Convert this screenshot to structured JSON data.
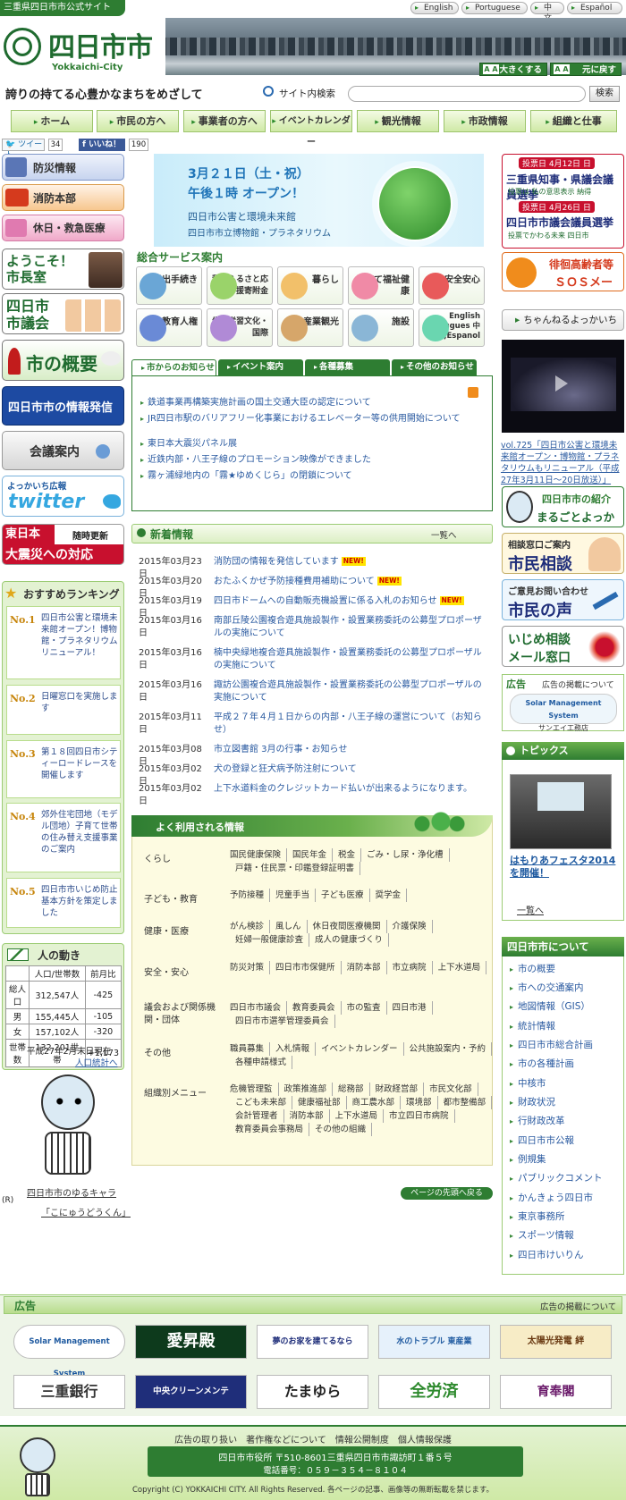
{
  "header": {
    "site_label": "三重県四日市市公式サイト",
    "languages": [
      "English",
      "Portuguese",
      "中文",
      "Español"
    ],
    "logo_text": "四日市市",
    "logo_sub": "Yokkaichi-City",
    "font_large": "大きくする",
    "font_reset": "元に戻す",
    "slogan": "誇りの持てる心豊かなまちをめざして",
    "search_label": "サイト内検索",
    "search_value": "",
    "search_button": "検索"
  },
  "nav": [
    "ホーム",
    "市民の方へ",
    "事業者の方へ",
    "イベントカレンダー",
    "観光情報",
    "市政情報",
    "組織と仕事"
  ],
  "social": {
    "tweet": "ツイート",
    "tweet_count": "34",
    "like": "いいね！",
    "like_count": "190"
  },
  "left_buttons": [
    "防災情報",
    "消防本部",
    "休日・救急医療"
  ],
  "left_banners": {
    "mayor": "ようこそ！市長室",
    "council": "四日市市議会",
    "overview": "市の概要",
    "info": "四日市市の情報発信",
    "meeting": "会議案内",
    "twitter_top": "よっかいち広報",
    "twitter": "twitter",
    "quake_top": "東日本",
    "quake_tag": "随時更新",
    "quake": "大震災への対応"
  },
  "ranking": {
    "title": "おすすめランキング",
    "items": [
      {
        "no": "No.1",
        "text": "四日市公害と環境未来館オープン！博物館・プラネタリウムリニューアル！"
      },
      {
        "no": "No.2",
        "text": "日曜窓口を実施します"
      },
      {
        "no": "No.3",
        "text": "第１８回四日市シティーロードレースを開催します"
      },
      {
        "no": "No.4",
        "text": "郊外住宅団地（モデル団地）子育て世帯の住み替え支援事業のご案内"
      },
      {
        "no": "No.5",
        "text": "四日市市いじめ防止基本方針を策定しました"
      }
    ]
  },
  "population": {
    "title": "人の動き",
    "headers": [
      "",
      "人口/世帯数",
      "前月比"
    ],
    "rows": [
      {
        "label": "総人口",
        "value": "312,547人",
        "diff": "-425"
      },
      {
        "label": "男",
        "value": "155,445人",
        "diff": "-105"
      },
      {
        "label": "女",
        "value": "157,102人",
        "diff": "-320"
      },
      {
        "label": "世帯数",
        "value": "132,201世帯",
        "diff": "+1,173"
      }
    ],
    "note": "平成27年2月末日現在",
    "link": "人口統計へ"
  },
  "mascot": {
    "caption": "四日市市のゆるキャラ",
    "r": "(R)",
    "name": "「こにゅうどうくん」"
  },
  "hero": {
    "line1": "3月２１日（土・祝）",
    "line2": "午後１時 オープン！",
    "line3": "四日市公害と環境未来館",
    "line4": "四日市市立博物館・プラネタリウム"
  },
  "services": {
    "title": "総合サービス案内",
    "items": [
      "届出手続き",
      "税金ふるさと応援寄附金",
      "暮らし",
      "子育て福祉健康",
      "安全安心",
      "教育人権",
      "生涯学習文化・国際",
      "産業観光",
      "施設",
      "English Portugues 中文,Espanol"
    ]
  },
  "news_tabs": [
    "市からのお知らせ",
    "イベント案内",
    "各種募集",
    "その他のお知らせ"
  ],
  "news_items": [
    "鉄道事業再構築実施計画の国土交通大臣の認定について",
    "JR四日市駅のバリアフリー化事業におけるエレベーター等の供用開始について",
    "東日本大震災パネル展",
    "近鉄内部・八王子線のプロモーション映像ができました",
    "霧ヶ浦緑地内の「霧★ゆめくじら」の閉鎖について"
  ],
  "new_info": {
    "title": "新着情報",
    "list_link": "一覧へ",
    "new_badge": "NEW!",
    "rows": [
      {
        "date": "2015年03月23日",
        "text": "消防団の情報を発信しています",
        "new": true
      },
      {
        "date": "2015年03月20日",
        "text": "おたふくかぜ予防接種費用補助について",
        "new": true
      },
      {
        "date": "2015年03月19日",
        "text": "四日市ドームへの自動販売機設置に係る入札のお知らせ",
        "new": true
      },
      {
        "date": "2015年03月16日",
        "text": "南部丘陵公園複合遊具施設製作・設置業務委託の公募型プロポーザルの実施について",
        "new": false
      },
      {
        "date": "2015年03月16日",
        "text": "楠中央緑地複合遊具施設製作・設置業務委託の公募型プロポーザルの実施について",
        "new": false
      },
      {
        "date": "2015年03月16日",
        "text": "諏訪公園複合遊具施設製作・設置業務委託の公募型プロポーザルの実施について",
        "new": false
      },
      {
        "date": "2015年03月11日",
        "text": "平成２７年４月１日からの内部・八王子線の運営について（お知らせ）",
        "new": false
      },
      {
        "date": "2015年03月08日",
        "text": "市立図書館 3月の行事・お知らせ",
        "new": false
      },
      {
        "date": "2015年03月02日",
        "text": "犬の登録と狂犬病予防注射について",
        "new": false
      },
      {
        "date": "2015年03月02日",
        "text": "上下水道料金のクレジットカード払いが出来るようになります。",
        "new": false
      }
    ]
  },
  "frequent": {
    "title": "よく利用される情報",
    "rows": [
      {
        "cat": "くらし",
        "links": [
          "国民健康保険",
          "国民年金",
          "税金",
          "ごみ・し尿・浄化槽",
          "戸籍・住民票・印鑑登録証明書"
        ]
      },
      {
        "cat": "子ども・教育",
        "links": [
          "予防接種",
          "児童手当",
          "子ども医療",
          "奨学金"
        ]
      },
      {
        "cat": "健康・医療",
        "links": [
          "がん検診",
          "風しん",
          "休日夜間医療機関",
          "介護保険",
          "妊婦一般健康診査",
          "成人の健康づくり"
        ]
      },
      {
        "cat": "安全・安心",
        "links": [
          "防災対策",
          "四日市市保健所",
          "消防本部",
          "市立病院",
          "上下水道局"
        ]
      },
      {
        "cat": "議会および関係機関・団体",
        "links": [
          "四日市市議会",
          "教育委員会",
          "市の監査",
          "四日市港",
          "四日市市選挙管理委員会"
        ]
      },
      {
        "cat": "その他",
        "links": [
          "職員募集",
          "入札情報",
          "イベントカレンダー",
          "公共施設案内・予約",
          "各種申請様式"
        ]
      },
      {
        "cat": "組織別メニュー",
        "links": [
          "危機管理監",
          "政策推進部",
          "総務部",
          "財政経営部",
          "市民文化部",
          "こども未来部",
          "健康福祉部",
          "商工農水部",
          "環境部",
          "都市整備部",
          "会計管理者",
          "消防本部",
          "上下水道局",
          "市立四日市病院",
          "教育委員会事務局",
          "その他の組織"
        ]
      }
    ]
  },
  "page_top": "ページの先頭へ戻る",
  "right": {
    "election1_date": "投票日 4月12日 日",
    "election1": "三重県知事・県議会議員選挙",
    "election1_sub": "投票は 私の意思表示 納得",
    "election2_date": "投票日 4月26日 日",
    "election2": "四日市市議会議員選挙",
    "election2_sub": "投票でかわる未来 四日市",
    "sos_top": "徘徊高齢者等",
    "sos": "ＳＯＳメール",
    "channel": "ちゃんねるよっかいち",
    "video_caption": "vol.725「四日市公害と環境未来館オープン・博物館・プラネタリウムもリニューアル（平成27年3月11日～20日放送）」",
    "intro_top": "四日市市の紹介",
    "intro": "まるごとよっかいち",
    "consult_top": "相談窓口ご案内",
    "consult": "市民相談",
    "voice_top": "ご意見お問い合わせ",
    "voice": "市民の声",
    "bully_top": "いじめ相談",
    "bully": "メール窓口",
    "ad_label": "広告",
    "ad_link": "広告の掲載について",
    "ad_sponsor": "Solar Management System",
    "ad_sponsor_sub": "サンエイ工務店",
    "topics_title": "トピックス",
    "topics_link": "はもりあフェスタ2014を開催！",
    "topics_list": "一覧へ",
    "about_title": "四日市市について",
    "about": [
      "市の概要",
      "市への交通案内",
      "地図情報（GIS）",
      "統計情報",
      "四日市市総合計画",
      "市の各種計画",
      "中核市",
      "財政状況",
      "行財政改革",
      "四日市市公報",
      "例規集",
      "パブリックコメント",
      "かんきょう四日市",
      "東京事務所",
      "スポーツ情報",
      "四日市けいりん"
    ]
  },
  "ads": {
    "title": "広告",
    "link": "広告の掲載について",
    "items": [
      "Solar Management System",
      "愛昇殿",
      "夢のお家を建てるなら",
      "水のトラブル 東産業",
      "太陽光発電 絆",
      "三重銀行",
      "中央クリーンメンテ",
      "たまゆら",
      "全労済",
      "育奉閣"
    ]
  },
  "footer": {
    "links": [
      "広告の取り扱い",
      "著作権などについて",
      "情報公開制度",
      "個人情報保護"
    ],
    "address": "四日市市役所 〒510-8601三重県四日市市諏訪町１番５号",
    "phone": "電話番号：０５９－３５４－８１０４",
    "copyright": "Copyright (C) YOKKAICHI CITY. All Rights Reserved. 各ページの記事、画像等の無断転載を禁じます。"
  },
  "colors": {
    "green": "#2e7d32",
    "light_green": "#e8f3d6",
    "red": "#c8102e",
    "link": "#2a5aa0",
    "yellow_panel": "#fdfbe1"
  }
}
